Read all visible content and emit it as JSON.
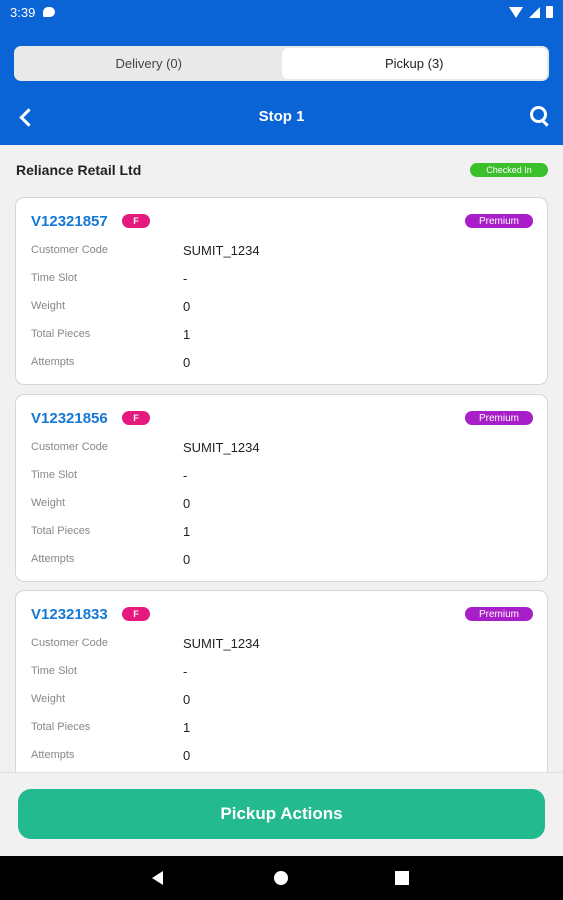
{
  "status_bar": {
    "time": "3:39"
  },
  "tabs": [
    {
      "label": "Delivery (0)",
      "active": false
    },
    {
      "label": "Pickup (3)",
      "active": true
    }
  ],
  "header": {
    "title": "Stop 1"
  },
  "stop": {
    "name": "Reliance Retail Ltd",
    "status": "Checked In"
  },
  "labels": {
    "customer_code": "Customer Code",
    "time_slot": "Time Slot",
    "weight": "Weight",
    "total_pieces": "Total Pieces",
    "attempts": "Attempts"
  },
  "cards": [
    {
      "awb": "V12321857",
      "flag": "F",
      "tier": "Premium",
      "customer_code": "SUMIT_1234",
      "time_slot": "-",
      "weight": "0",
      "total_pieces": "1",
      "attempts": "0"
    },
    {
      "awb": "V12321856",
      "flag": "F",
      "tier": "Premium",
      "customer_code": "SUMIT_1234",
      "time_slot": "-",
      "weight": "0",
      "total_pieces": "1",
      "attempts": "0"
    },
    {
      "awb": "V12321833",
      "flag": "F",
      "tier": "Premium",
      "customer_code": "SUMIT_1234",
      "time_slot": "-",
      "weight": "0",
      "total_pieces": "1",
      "attempts": "0"
    }
  ],
  "footer": {
    "action_label": "Pickup Actions"
  },
  "colors": {
    "primary_blue": "#0a64d6",
    "awb_blue": "#1478d4",
    "checked_in_green": "#3bbf2b",
    "flag_pink": "#e5197d",
    "premium_purple": "#a81ec8",
    "action_green": "#23ba90"
  },
  "icons": {
    "status_notification": "notification-icon",
    "status_wifi": "wifi-icon",
    "status_signal": "signal-icon",
    "status_battery": "battery-icon",
    "back": "back-arrow-icon",
    "search": "search-icon",
    "nav_back": "nav-back-icon",
    "nav_home": "nav-home-icon",
    "nav_recents": "nav-recents-icon"
  }
}
